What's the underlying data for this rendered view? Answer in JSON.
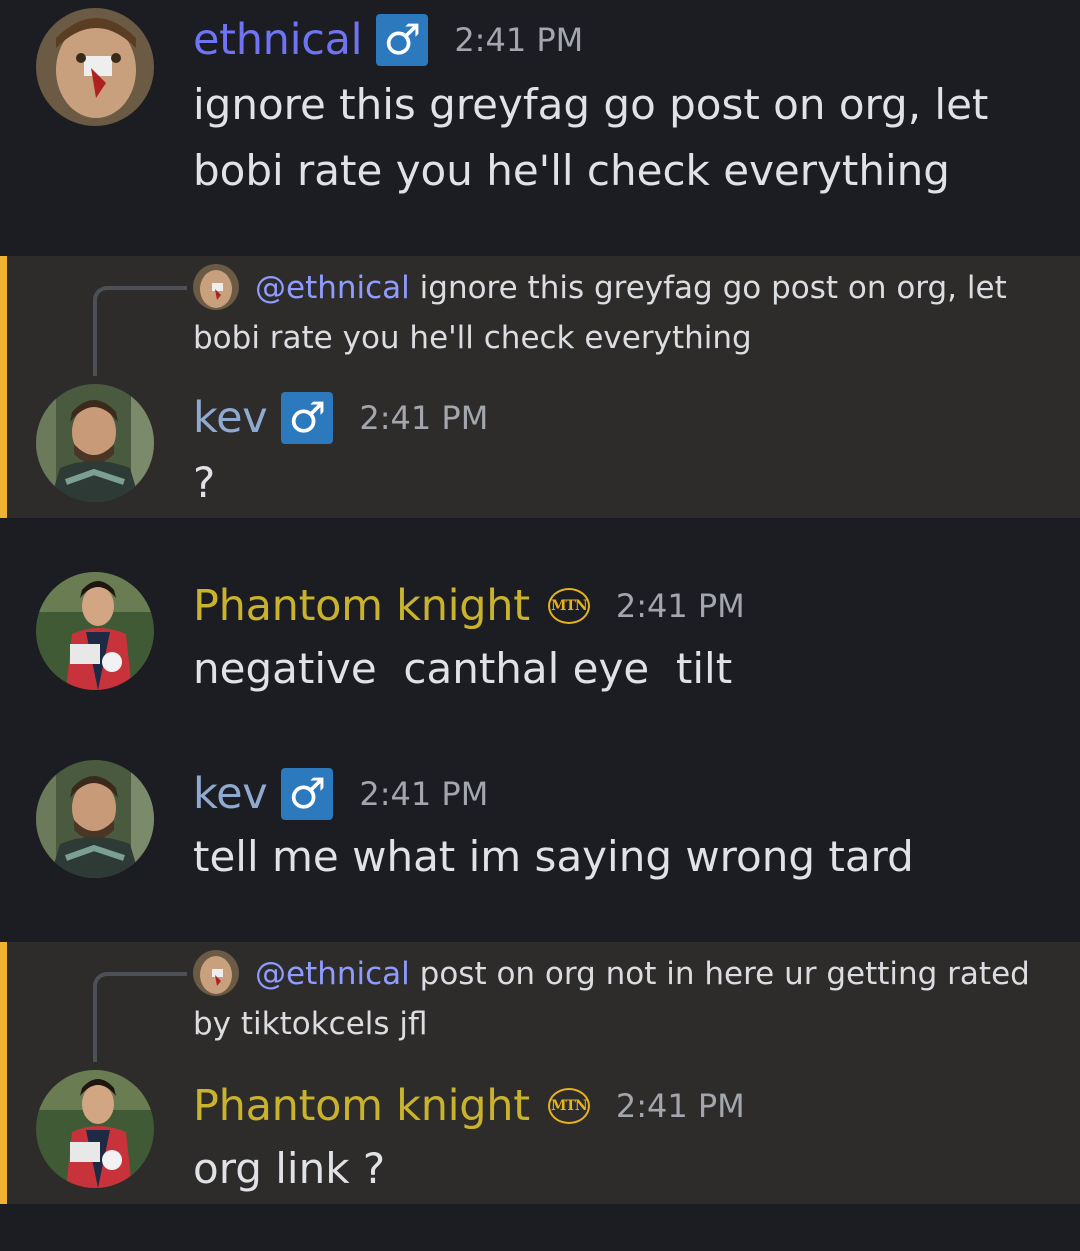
{
  "messages": [
    {
      "username": "ethnical",
      "badge": "♂",
      "time": "2:41 PM",
      "text": "ignore this greyfag go post on org, let bobi rate you he'll check everything",
      "avatar": "ethnical-avatar"
    },
    {
      "username": "kev",
      "badge": "♂",
      "time": "2:41 PM",
      "text": "?",
      "avatar": "kev-avatar",
      "reply": {
        "mention": "@ethnical",
        "text": "ignore this greyfag go post on org, let bobi rate you he'll check everything"
      }
    },
    {
      "username": "Phantom knight",
      "badge": "MTN",
      "time": "2:41 PM",
      "text": "negative  canthal eye  tilt",
      "avatar": "phantom-avatar"
    },
    {
      "username": "kev",
      "badge": "♂",
      "time": "2:41 PM",
      "text": "tell me what im saying wrong tard",
      "avatar": "kev-avatar"
    },
    {
      "username": "Phantom knight",
      "badge": "MTN",
      "time": "2:41 PM",
      "text": "org link ?",
      "avatar": "phantom-avatar",
      "reply": {
        "mention": "@ethnical",
        "text": "post on org not in here ur getting rated by tiktokcels jfl"
      }
    }
  ],
  "colors": {
    "background": "#1c1d22",
    "mention_highlight": "#2d2c2b",
    "mention_bar": "#f0b232",
    "ethnical": "#6f74f4",
    "kev": "#8fa9d1",
    "phantom": "#c9b22e",
    "male_badge": "#2c79bd"
  }
}
